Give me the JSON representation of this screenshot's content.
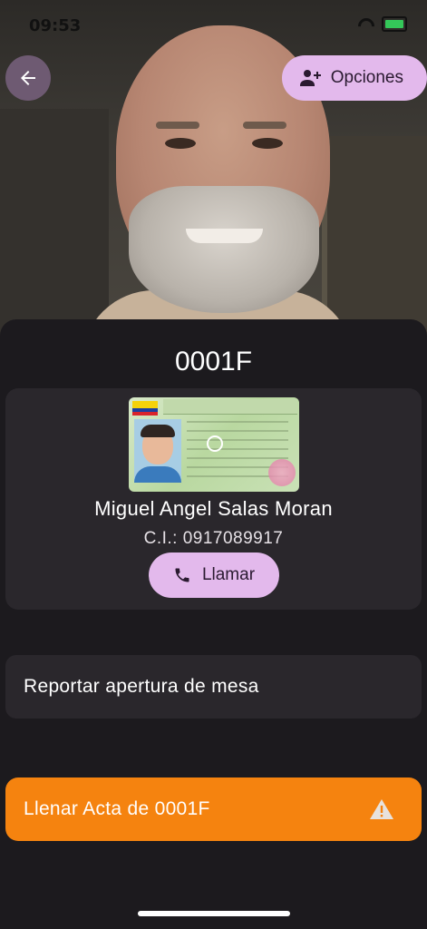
{
  "status_bar": {
    "time": "09:53"
  },
  "header": {
    "options_label": "Opciones"
  },
  "record": {
    "code": "0001F"
  },
  "person": {
    "name": "Miguel Angel Salas Moran",
    "ci": "C.I.: 0917089917",
    "call_label": "Llamar"
  },
  "actions": {
    "report_label": "Reportar apertura de mesa",
    "fill_label": "Llenar Acta de 0001F"
  },
  "colors": {
    "accent": "#e3b9ec",
    "warning": "#f5830f",
    "surface": "#2a272c",
    "background": "#1c1a1e"
  },
  "icons": {
    "back": "arrow-left-icon",
    "options": "person-add-icon",
    "call": "phone-icon",
    "warning": "warning-triangle-icon"
  }
}
